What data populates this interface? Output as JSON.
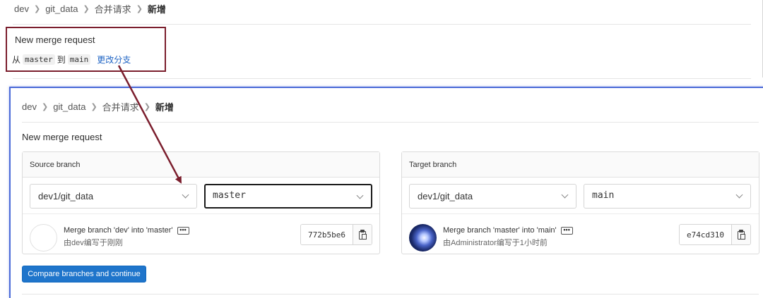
{
  "top": {
    "breadcrumb": [
      "dev",
      "git_data",
      "合并请求",
      "新增"
    ],
    "title": "New merge request",
    "from_label": "从",
    "source_branch": "master",
    "to_label": "到",
    "target_branch": "main",
    "change_link": "更改分支"
  },
  "panel": {
    "breadcrumb": [
      "dev",
      "git_data",
      "合并请求",
      "新增"
    ],
    "title": "New merge request",
    "source": {
      "header": "Source branch",
      "project": "dev1/git_data",
      "branch": "master",
      "commit_message": "Merge branch 'dev' into 'master'",
      "commit_meta": "由dev编写于刚刚",
      "sha": "772b5be6",
      "ellipsis": "•••"
    },
    "target": {
      "header": "Target branch",
      "project": "dev1/git_data",
      "branch": "main",
      "commit_message": "Merge branch 'master' into 'main'",
      "commit_meta": "由Administrator编写于1小时前",
      "sha": "e74cd310",
      "ellipsis": "•••"
    },
    "compare_button": "Compare branches and continue"
  },
  "colors": {
    "highlight_border": "#7b1e2d",
    "arrow": "#7b1e2d",
    "panel_border": "#4b6ad8",
    "primary_button": "#1f75cb",
    "link": "#1f64c4"
  }
}
